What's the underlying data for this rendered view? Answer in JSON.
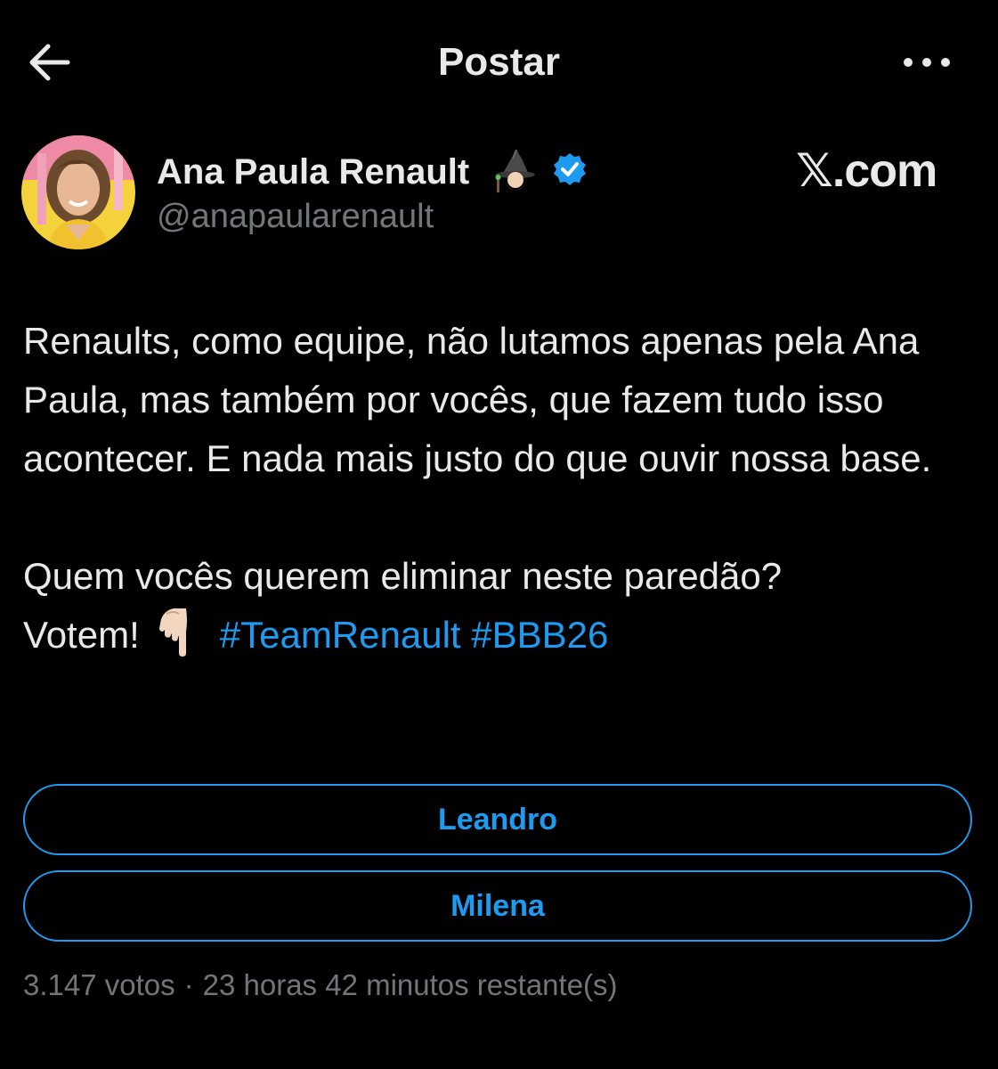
{
  "header": {
    "title": "Postar",
    "back_icon": "arrow-left-icon",
    "more_icon": "more-horizontal-icon"
  },
  "author": {
    "name": "Ana Paula Renault",
    "handle": "@anapaularenault",
    "name_emoji": "wizard-icon",
    "verified_icon": "verified-badge-icon",
    "verified_color": "#1d9bf0"
  },
  "watermark": "𝕏.com",
  "tweet": {
    "paragraph1": "Renaults, como equipe, não lutamos apenas pela Ana Paula, mas também por vocês, que fazem tudo isso acontecer. E nada mais justo do que ouvir nossa base.",
    "paragraph2_line1": "Quem vocês querem eliminar neste paredão?",
    "paragraph2_prefix": "Votem!",
    "pointing_emoji": "pointing-down-hand-icon",
    "hashtag1": "#TeamRenault",
    "hashtag2": "#BBB26"
  },
  "poll": {
    "options": [
      {
        "label": "Leandro"
      },
      {
        "label": "Milena"
      }
    ],
    "votes": "3.147 votos",
    "separator": "·",
    "time_left": "23 horas 42 minutos restante(s)"
  },
  "colors": {
    "background": "#000000",
    "text": "#e7e9ea",
    "secondary_text": "#71767b",
    "accent": "#1d9bf0"
  }
}
